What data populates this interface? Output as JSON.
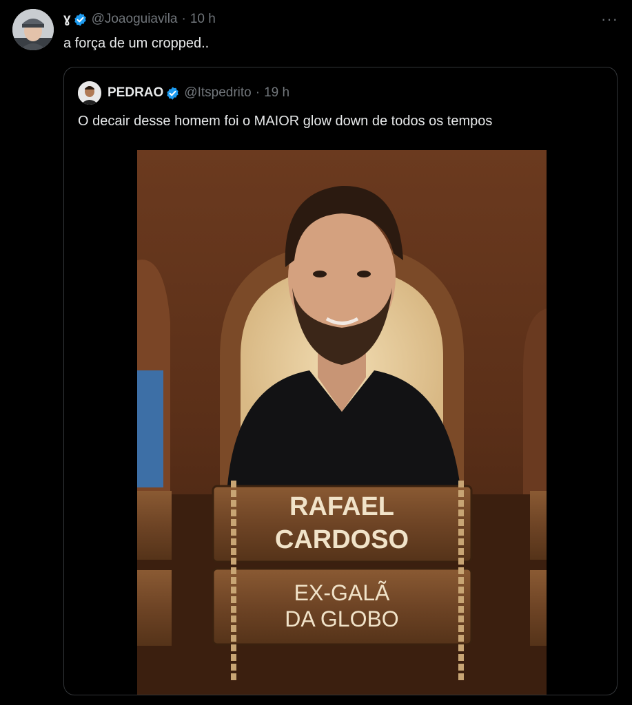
{
  "tweet": {
    "name": "ɣ",
    "handle": "@Joaoguiavila",
    "separator": "·",
    "time": "10 h",
    "more": "···",
    "text": "a força de um cropped.."
  },
  "quote": {
    "name": "PEDRAO",
    "handle": "@Itspedrito",
    "separator": "·",
    "time": "19 h",
    "text": "O decair desse homem foi o MAIOR glow down de todos os tempos"
  },
  "media": {
    "sign_top_line1": "RAFAEL",
    "sign_top_line2": "CARDOSO",
    "sign_bottom_line1": "EX-GALÃ",
    "sign_bottom_line2": "DA GLOBO"
  },
  "colors": {
    "background": "#000000",
    "text": "#e7e9ea",
    "muted": "#71767b",
    "verified": "#1d9bf0",
    "border": "#333639"
  }
}
